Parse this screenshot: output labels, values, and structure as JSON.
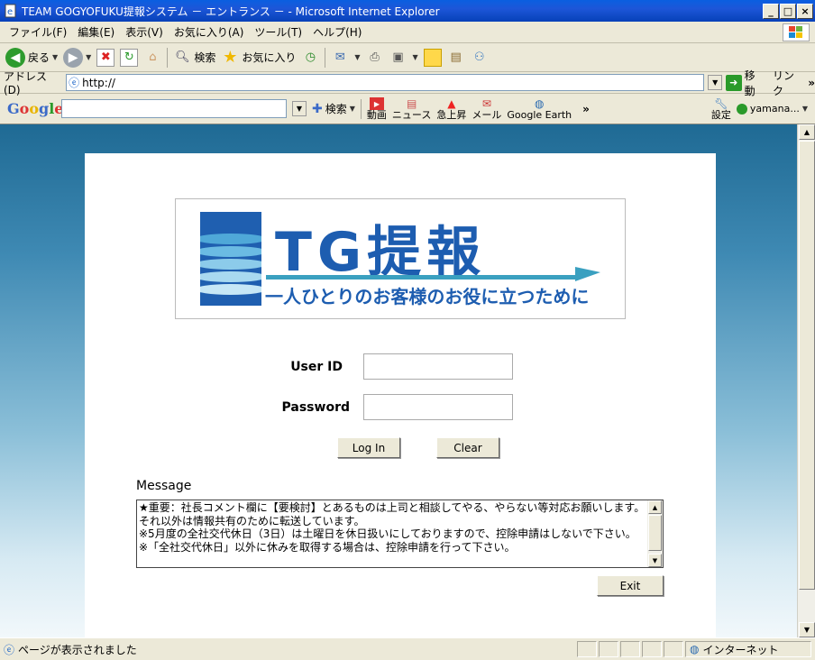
{
  "window": {
    "title": "TEAM GOGYOFUKU提報システム － エントランス － - Microsoft Internet Explorer",
    "buttons": [
      "_",
      "□",
      "×"
    ]
  },
  "menubar": [
    "ファイル(F)",
    "編集(E)",
    "表示(V)",
    "お気に入り(A)",
    "ツール(T)",
    "ヘルプ(H)"
  ],
  "toolbar": {
    "back": "戻る",
    "search": "検索",
    "favorites": "お気に入り"
  },
  "addressbar": {
    "label": "アドレス(D)",
    "url": "http://",
    "go": "移動",
    "links": "リンク"
  },
  "googlebar": {
    "logo": "Google",
    "search": "検索",
    "tools": [
      "動画",
      "ニュース",
      "急上昇",
      "メール",
      "Google Earth"
    ],
    "settings": "設定",
    "user": "yamana..."
  },
  "page": {
    "logo_title": "TG提報",
    "logo_tagline": "一人ひとりのお客様のお役に立つために",
    "userid_label": "User ID",
    "password_label": "Password",
    "login_button": "Log In",
    "clear_button": "Clear",
    "message_label": "Message",
    "message_text": "★重要：社長コメント欄に【要検討】とあるものは上司と相談してやる、やらない等対応お願いします。それ以外は情報共有のために転送しています。\n※5月度の全社交代休日（3日）は土曜日を休日扱いにしておりますので、控除申請はしないで下さい。\n※「全社交代休日」以外に休みを取得する場合は、控除申請を行って下さい。",
    "exit_button": "Exit"
  },
  "statusbar": {
    "text": "ページが表示されました",
    "zone": "インターネット"
  },
  "colors": {
    "title_blue": "#0a5fe0",
    "logo_blue": "#1d5db0",
    "logo_accent": "#3aa0c0"
  }
}
